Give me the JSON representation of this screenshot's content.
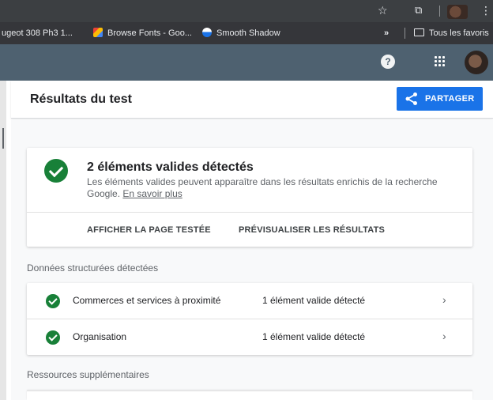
{
  "bookmarks": {
    "items": [
      {
        "label": "ugeot 308 Ph3 1..."
      },
      {
        "label": "Browse Fonts - Goo..."
      },
      {
        "label": "Smooth Shadow"
      }
    ],
    "overflow": "»",
    "all_bookmarks": "Tous les favoris"
  },
  "header": {
    "help_glyph": "?"
  },
  "panel": {
    "title": "Résultats du test",
    "share_label": "PARTAGER"
  },
  "summary": {
    "title": "2 éléments valides détectés",
    "description": "Les éléments valides peuvent apparaître dans les résultats enrichis de la recherche Google.",
    "learn_more": "En savoir plus",
    "actions": [
      {
        "label": "AFFICHER LA PAGE TESTÉE"
      },
      {
        "label": "PRÉVISUALISER LES RÉSULTATS"
      }
    ]
  },
  "structured": {
    "section_label": "Données structurées détectées",
    "rows": [
      {
        "name": "Commerces et services à proximité",
        "status": "1 élément valide détecté"
      },
      {
        "name": "Organisation",
        "status": "1 élément valide détecté"
      }
    ]
  },
  "resources": {
    "section_label": "Ressources supplémentaires"
  },
  "colors": {
    "accent": "#1a73e8",
    "success": "#188038",
    "header_bg": "#4e6170"
  }
}
